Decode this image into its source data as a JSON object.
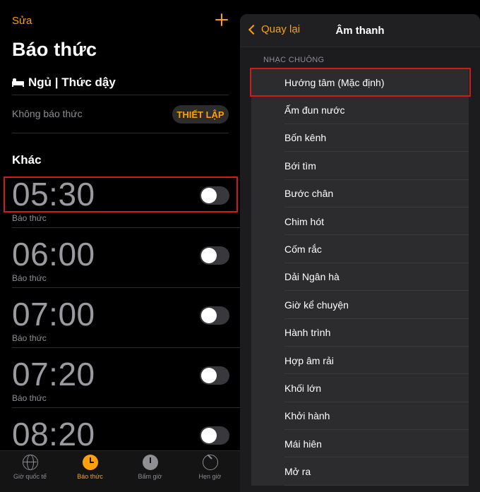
{
  "alarm_screen": {
    "edit_label": "Sửa",
    "title": "Báo thức",
    "sleep_label": "Ngủ | Thức dậy",
    "no_alarm_label": "Không báo thức",
    "setup_label": "THIẾT LẬP",
    "other_label": "Khác",
    "alarms": [
      {
        "time": "05:30",
        "label": "Báo thức",
        "enabled": false
      },
      {
        "time": "06:00",
        "label": "Báo thức",
        "enabled": false
      },
      {
        "time": "07:00",
        "label": "Báo thức",
        "enabled": false
      },
      {
        "time": "07:20",
        "label": "Báo thức",
        "enabled": false
      },
      {
        "time": "08:20",
        "label": "",
        "enabled": false
      }
    ],
    "tabs": [
      {
        "label": "Giờ quốc tế",
        "icon": "globe-icon",
        "active": false
      },
      {
        "label": "Báo thức",
        "icon": "alarm-clock-icon",
        "active": true
      },
      {
        "label": "Bấm giờ",
        "icon": "stopwatch-icon",
        "active": false
      },
      {
        "label": "Hẹn giờ",
        "icon": "timer-icon",
        "active": false
      }
    ]
  },
  "sound_screen": {
    "back_label": "Quay lại",
    "title": "Âm thanh",
    "section_header": "NHẠC CHUÔNG",
    "ringtones": [
      "Hướng tâm (Mặc định)",
      "Ấm đun nước",
      "Bốn kênh",
      "Bới tìm",
      "Bước chân",
      "Chim hót",
      "Cốm rắc",
      "Dải Ngân hà",
      "Giờ kể chuyện",
      "Hành trình",
      "Hợp âm rải",
      "Khối lớn",
      "Khởi hành",
      "Mái hiên",
      "Mở ra"
    ]
  },
  "colors": {
    "accent": "#ff9f0a",
    "highlight_box": "#d11a1a",
    "background": "#000000",
    "panel": "#1c1c1e"
  }
}
